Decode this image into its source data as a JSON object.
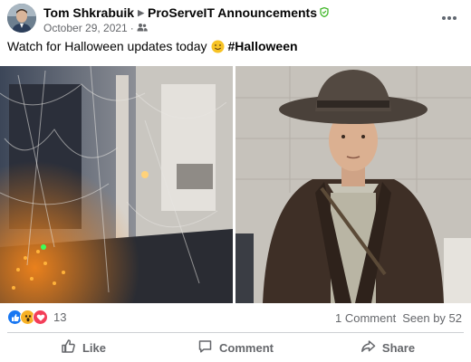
{
  "post": {
    "author": "Tom Shkrabuik",
    "group": "ProServeIT Announcements",
    "date": "October 29, 2021",
    "separator": "·",
    "text": "Watch for Halloween updates today",
    "hashtag": "#Halloween"
  },
  "stats": {
    "reaction_count": "13",
    "comments": "1 Comment",
    "seen_by": "Seen by 52"
  },
  "actions": {
    "like": "Like",
    "comment": "Comment",
    "share": "Share"
  },
  "colors": {
    "like_blue": "#1877f2",
    "love_red": "#f33e58",
    "wow_yellow": "#f7b125",
    "admin_green": "#42b72a",
    "secondary_text": "#65676b"
  },
  "icons": [
    "more-options-icon",
    "admin-shield-icon",
    "group-audience-icon",
    "like-icon",
    "comment-icon",
    "share-icon"
  ]
}
